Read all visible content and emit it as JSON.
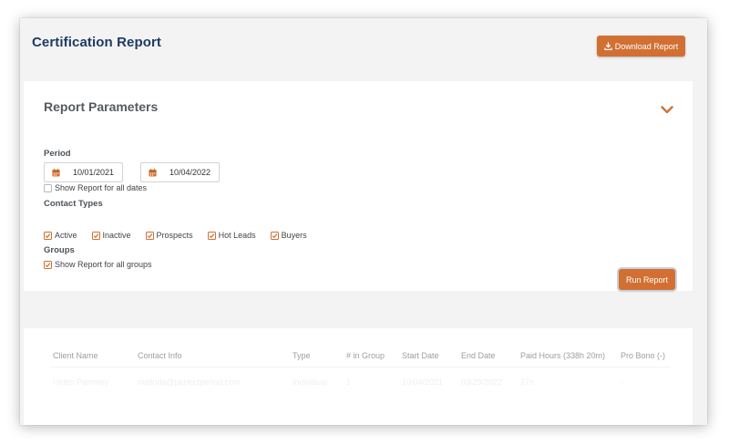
{
  "header": {
    "title": "Certification Report",
    "download_label": "Download Report"
  },
  "params": {
    "title": "Report Parameters",
    "period_label": "Period",
    "start_date": "10/01/2021",
    "end_date": "10/04/2022",
    "all_dates": {
      "label": "Show Report for all dates",
      "checked": false
    },
    "contact_types_label": "Contact Types",
    "contact_types": [
      {
        "label": "Active",
        "checked": true
      },
      {
        "label": "Inactive",
        "checked": true
      },
      {
        "label": "Prospects",
        "checked": true
      },
      {
        "label": "Hot Leads",
        "checked": true
      },
      {
        "label": "Buyers",
        "checked": true
      }
    ],
    "groups_label": "Groups",
    "all_groups": {
      "label": "Show Report for all groups",
      "checked": true
    },
    "run_label": "Run Report"
  },
  "table": {
    "columns": [
      "Client Name",
      "Contact Info",
      "Type",
      "# in Group",
      "Start Date",
      "End Date",
      "Paid Hours (338h 20m)",
      "Pro Bono (-)"
    ],
    "rows": [
      [
        "Helen Pammey",
        "melinda@perfectperiod.com",
        "Individual",
        "1",
        "10/04/2021",
        "03/29/2022",
        "27h",
        "-"
      ]
    ]
  },
  "colors": {
    "accent": "#d27033",
    "title": "#1d3b63",
    "background": "#f3f3f3"
  },
  "icons": {
    "download": "download-icon",
    "calendar": "calendar-icon",
    "chevron": "chevron-down-icon",
    "check": "check-icon"
  }
}
